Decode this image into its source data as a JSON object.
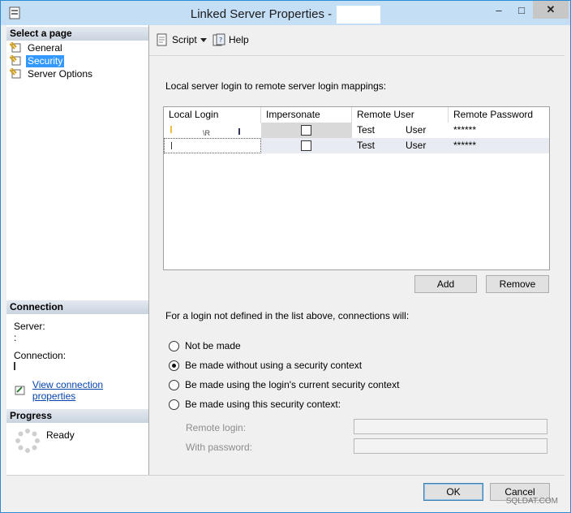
{
  "window": {
    "title": "Linked Server Properties -",
    "controls": {
      "minimize": "‒",
      "maximize": "□",
      "close": "✕"
    }
  },
  "sidebar": {
    "select_page_header": "Select a page",
    "pages": [
      {
        "label": "General",
        "icon": "page-icon"
      },
      {
        "label": "Security",
        "icon": "page-icon",
        "selected": true
      },
      {
        "label": "Server Options",
        "icon": "page-icon"
      }
    ],
    "connection_header": "Connection",
    "server_label": "Server:",
    "connection_label": "Connection:",
    "view_connection_properties": "View connection properties",
    "progress_header": "Progress",
    "progress_status": "Ready"
  },
  "toolbar": {
    "script_label": "Script",
    "help_label": "Help"
  },
  "main": {
    "mapping_caption": "Local server login to remote server login mappings:",
    "columns": [
      "Local Login",
      "Impersonate",
      "Remote User",
      "Remote Password"
    ],
    "rows": [
      {
        "local_login": "",
        "impersonate": false,
        "remote_user": "Test",
        "remote_user_suffix": "User",
        "remote_password": "******"
      },
      {
        "local_login": "",
        "impersonate": false,
        "remote_user": "Test",
        "remote_user_suffix": "User",
        "remote_password": "******"
      }
    ],
    "add_button": "Add",
    "remove_button": "Remove",
    "undefined_login_caption": "For a login not defined in the list above, connections will:",
    "options": [
      {
        "label": "Not be made",
        "checked": false
      },
      {
        "label": "Be made without using a security context",
        "checked": true
      },
      {
        "label": "Be made using the login's current security context",
        "checked": false
      },
      {
        "label": "Be made using this security context:",
        "checked": false
      }
    ],
    "remote_login_label": "Remote login:",
    "with_password_label": "With password:",
    "remote_login_value": "",
    "with_password_value": ""
  },
  "footer": {
    "ok_button": "OK",
    "cancel_button": "Cancel",
    "watermark": "SQLDAT.COM"
  },
  "colors": {
    "titlebar": "#c4dff5",
    "selected": "#3399ff",
    "link": "#0645ad"
  }
}
